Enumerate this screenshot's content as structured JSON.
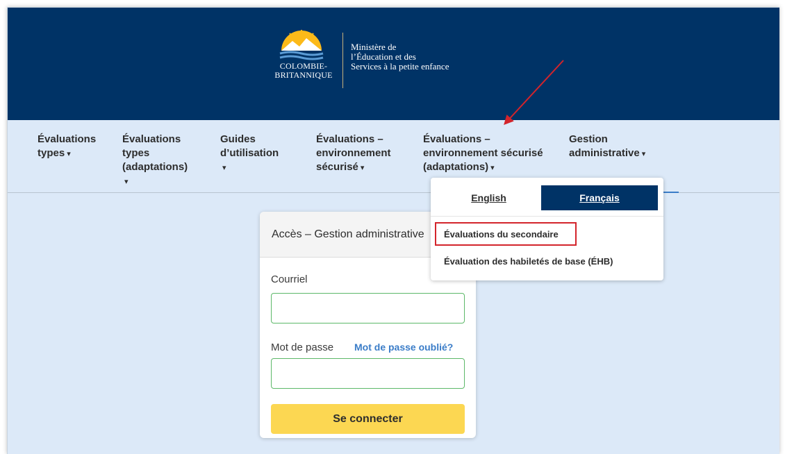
{
  "header": {
    "logo_province": [
      "COLOMBIE-",
      "BRITANNIQUE"
    ],
    "ministry_lines": [
      "Ministère de",
      "l’Éducation et des",
      "Services à la petite enfance"
    ]
  },
  "nav": {
    "items": [
      {
        "lines": [
          "Évaluations",
          "types"
        ]
      },
      {
        "lines": [
          "Évaluations",
          "types",
          "(adaptations)"
        ]
      },
      {
        "lines": [
          "Guides",
          "d’utilisation"
        ]
      },
      {
        "lines": [
          "Évaluations –",
          "environnement",
          "sécurisé"
        ]
      },
      {
        "lines": [
          "Évaluations –",
          "environnement sécurisé",
          "(adaptations)"
        ]
      },
      {
        "lines": [
          "Gestion",
          "administrative"
        ]
      }
    ]
  },
  "dropdown": {
    "lang_english": "English",
    "lang_french": "Français",
    "item_secondary": "Évaluations du secondaire",
    "item_fsa": "Évaluation des habiletés de base (ÉHB)"
  },
  "login": {
    "title": "Accès – Gestion administrative",
    "email_label": "Courriel",
    "email_value": "",
    "password_label": "Mot de passe",
    "password_value": "",
    "forgot_link": "Mot de passe oublié?",
    "submit_label": "Se connecter"
  },
  "colors": {
    "banner": "#003366",
    "nav_bg": "#dce9f8",
    "accent_yellow": "#fcd752",
    "link_blue": "#3b7dc8",
    "highlight_red": "#d3242b"
  }
}
